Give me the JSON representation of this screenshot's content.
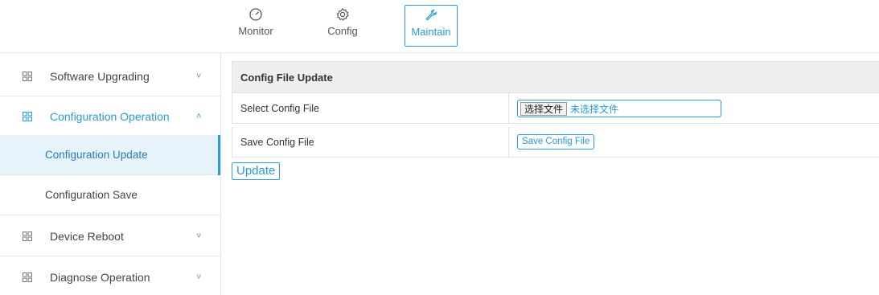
{
  "topnav": {
    "items": [
      {
        "label": "Monitor",
        "icon": "gauge-icon"
      },
      {
        "label": "Config",
        "icon": "gear-icon"
      },
      {
        "label": "Maintain",
        "icon": "wrench-icon",
        "active": true
      }
    ]
  },
  "sidebar": {
    "groups": [
      {
        "label": "Software Upgrading",
        "chevron": "˅"
      },
      {
        "label": "Configuration Operation",
        "chevron": "˄",
        "expanded": true
      },
      {
        "label": "Device Reboot",
        "chevron": "˅"
      },
      {
        "label": "Diagnose Operation",
        "chevron": "˅"
      }
    ],
    "subitems": [
      {
        "label": "Configuration Update",
        "active": true
      },
      {
        "label": "Configuration Save"
      }
    ]
  },
  "main": {
    "panel_title": "Config File Update",
    "rows": [
      {
        "label": "Select Config File",
        "file_button": "选择文件",
        "file_status": "未选择文件"
      },
      {
        "label": "Save Config File",
        "button": "Save Config File"
      }
    ],
    "update_button": "Update"
  },
  "colors": {
    "accent": "#2a9ad6",
    "active_bg": "#e6f3fb",
    "header_bg": "#efefef"
  }
}
